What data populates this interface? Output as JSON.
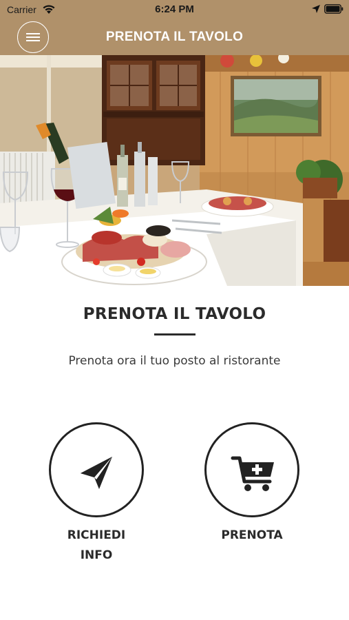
{
  "status_bar": {
    "carrier": "Carrier",
    "time": "6:24 PM"
  },
  "nav": {
    "title": "PRENOTA IL TAVOLO",
    "menu_icon": "hamburger-menu-icon"
  },
  "hero": {
    "description_icon": "restaurant-photo"
  },
  "content": {
    "title": "PRENOTA IL TAVOLO",
    "subtitle": "Prenota ora il tuo posto al ristorante"
  },
  "actions": [
    {
      "label_line1": "RICHIEDI",
      "label_line2": "INFO",
      "icon": "paper-plane-icon"
    },
    {
      "label": "PRENOTA",
      "icon": "cart-plus-icon"
    }
  ],
  "colors": {
    "header_bg": "#b0916a",
    "header_text": "#ffffff",
    "text_dark": "#2b2b2b"
  }
}
